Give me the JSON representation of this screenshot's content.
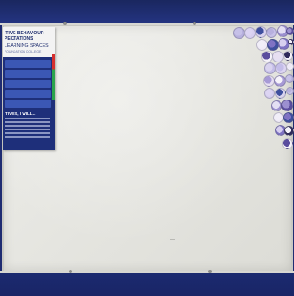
{
  "poster": {
    "title_line1": "ITIVE BEHAVIOUR",
    "title_line2": "PECTATIONS",
    "subtitle": "LEARNING SPACES",
    "org": "FOUNDATION COLLEGE",
    "section": "TIVES, I WILL..."
  },
  "circle_colors": [
    "#c6c0e8",
    "#dcd4f2",
    "#3e4f9e",
    "#b7b0de",
    "#e4dff4",
    "#9c90d0",
    "#f1eef8",
    "#7f73c4",
    "#d7cff0",
    "#f4f2fb",
    "#5a4c9e",
    "#e7dff2",
    "#2f2a5a",
    "#d9d3ef",
    "#c4bde8",
    "#efeaf7",
    "#a79ad6",
    "#f6f3fa"
  ]
}
